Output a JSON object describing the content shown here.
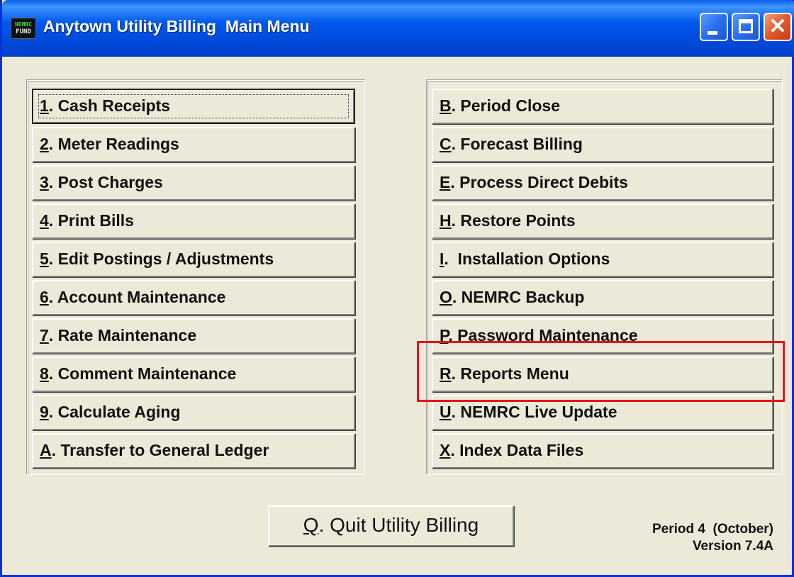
{
  "window": {
    "title": "Anytown Utility Billing  Main Menu",
    "icon_top": "NEMRC",
    "icon_bottom": "FUND",
    "controls": [
      "minimize-icon",
      "maximize-icon",
      "close-icon"
    ],
    "close_glyph": "✕"
  },
  "left_menu": [
    {
      "key": "1",
      "label": ". Cash Receipts",
      "focused": true
    },
    {
      "key": "2",
      "label": ". Meter Readings"
    },
    {
      "key": "3",
      "label": ". Post Charges"
    },
    {
      "key": "4",
      "label": ". Print Bills"
    },
    {
      "key": "5",
      "label": ". Edit Postings / Adjustments"
    },
    {
      "key": "6",
      "label": ". Account Maintenance"
    },
    {
      "key": "7",
      "label": ". Rate Maintenance"
    },
    {
      "key": "8",
      "label": ". Comment Maintenance"
    },
    {
      "key": "9",
      "label": ". Calculate Aging"
    },
    {
      "key": "A",
      "label": ". Transfer to General Ledger"
    }
  ],
  "right_menu": [
    {
      "key": "B",
      "label": ". Period Close"
    },
    {
      "key": "C",
      "label": ". Forecast Billing"
    },
    {
      "key": "E",
      "label": ". Process Direct Debits"
    },
    {
      "key": "H",
      "label": ". Restore Points"
    },
    {
      "key": "I",
      "label": ".  Installation Options"
    },
    {
      "key": "O",
      "label": ". NEMRC Backup"
    },
    {
      "key": "P",
      "label": ". Password Maintenance"
    },
    {
      "key": "R",
      "label": ". Reports Menu",
      "highlighted": true
    },
    {
      "key": "U",
      "label": ". NEMRC Live Update"
    },
    {
      "key": "X",
      "label": ". Index Data Files"
    }
  ],
  "quit_button": {
    "key": "Q",
    "label": ". Quit Utility Billing"
  },
  "status": {
    "period": "Period 4  (October)",
    "version": "Version 7.4A"
  },
  "colors": {
    "titlebar": "#0058ee",
    "face": "#ece9d8",
    "highlight": "#e8101a"
  }
}
